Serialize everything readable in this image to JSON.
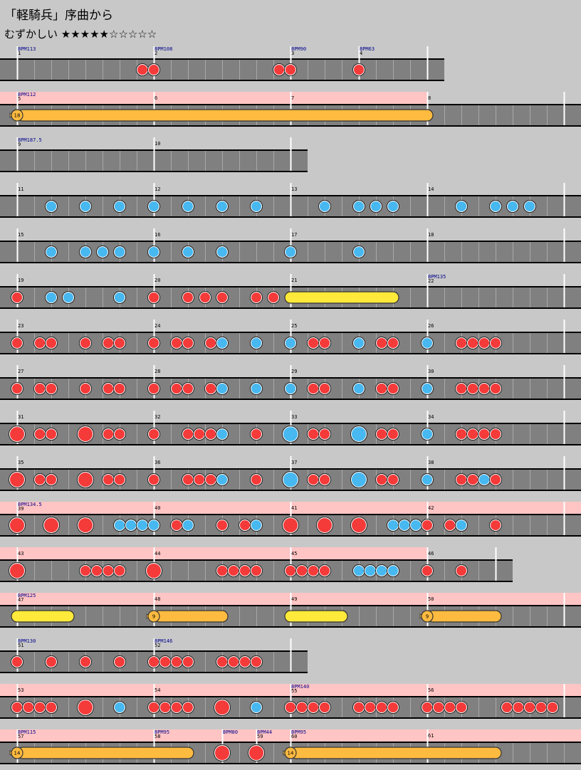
{
  "song": {
    "title": "「軽騎兵」序曲から",
    "difficulty": "むずかしい ★★★★★☆☆☆☆☆"
  },
  "colors": {
    "don": "#f53a3a",
    "ka": "#47b8f0",
    "drumroll": "#ffbb40",
    "balloon": "#ffbb40",
    "renda": "#ffe93a",
    "lane": "#808080",
    "gogo": "#ffc4c4",
    "bpm": "#00008b"
  },
  "rows": [
    {
      "width": 624,
      "gogo": false,
      "measures": [
        {
          "pos": 24,
          "num": "1",
          "bpm": "BPM113"
        },
        {
          "pos": 216,
          "num": "2",
          "bpm": "BPM108"
        },
        {
          "pos": 408,
          "num": "3",
          "bpm": "BPM90"
        },
        {
          "pos": 504,
          "num": "4",
          "bpm": "BPM63"
        },
        {
          "pos": 600,
          "num": ""
        }
      ],
      "notes": [
        [
          "d",
          200
        ],
        [
          "d",
          216
        ],
        [
          "d",
          392
        ],
        [
          "d",
          408
        ],
        [
          "d",
          504
        ]
      ]
    },
    {
      "width": 816,
      "gogo": true,
      "gogoEnd": 600,
      "measures": [
        {
          "pos": 24,
          "num": "5",
          "bpm": "BPM112"
        },
        {
          "pos": 216,
          "num": "6"
        },
        {
          "pos": 408,
          "num": "7"
        },
        {
          "pos": 600,
          "num": "8"
        },
        {
          "pos": 792,
          "num": ""
        }
      ],
      "notes": [
        [
          "balloon",
          24,
          600,
          "18"
        ]
      ]
    },
    {
      "width": 432,
      "gogo": false,
      "measures": [
        {
          "pos": 24,
          "num": "9",
          "bpm": "BPM187.5"
        },
        {
          "pos": 216,
          "num": "10"
        },
        {
          "pos": 408,
          "num": ""
        }
      ],
      "notes": []
    },
    {
      "width": 816,
      "gogo": false,
      "measures": [
        {
          "pos": 24,
          "num": "11"
        },
        {
          "pos": 216,
          "num": "12"
        },
        {
          "pos": 408,
          "num": "13"
        },
        {
          "pos": 600,
          "num": "14"
        },
        {
          "pos": 792,
          "num": ""
        }
      ],
      "notes": [
        [
          "k",
          72
        ],
        [
          "k",
          120
        ],
        [
          "k",
          168
        ],
        [
          "k",
          216
        ],
        [
          "k",
          264
        ],
        [
          "k",
          312
        ],
        [
          "k",
          360
        ],
        [
          "k",
          456
        ],
        [
          "k",
          504
        ],
        [
          "k",
          528
        ],
        [
          "k",
          552
        ],
        [
          "k",
          648
        ],
        [
          "k",
          696
        ],
        [
          "k",
          720
        ],
        [
          "k",
          744
        ]
      ]
    },
    {
      "width": 816,
      "gogo": false,
      "measures": [
        {
          "pos": 24,
          "num": "15"
        },
        {
          "pos": 216,
          "num": "16"
        },
        {
          "pos": 408,
          "num": "17"
        },
        {
          "pos": 600,
          "num": "18"
        },
        {
          "pos": 792,
          "num": ""
        }
      ],
      "notes": [
        [
          "k",
          72
        ],
        [
          "k",
          120
        ],
        [
          "k",
          144
        ],
        [
          "k",
          168
        ],
        [
          "k",
          216
        ],
        [
          "k",
          264
        ],
        [
          "k",
          312
        ],
        [
          "k",
          408
        ],
        [
          "k",
          504
        ]
      ]
    },
    {
      "width": 816,
      "gogo": false,
      "measures": [
        {
          "pos": 24,
          "num": "19"
        },
        {
          "pos": 216,
          "num": "20"
        },
        {
          "pos": 408,
          "num": "21"
        },
        {
          "pos": 600,
          "num": "22",
          "bpm": "BPM135"
        },
        {
          "pos": 792,
          "num": ""
        }
      ],
      "notes": [
        [
          "d",
          24
        ],
        [
          "k",
          72
        ],
        [
          "k",
          96
        ],
        [
          "k",
          168
        ],
        [
          "d",
          216
        ],
        [
          "d",
          264
        ],
        [
          "d",
          288
        ],
        [
          "d",
          312
        ],
        [
          "d",
          360
        ],
        [
          "d",
          384
        ],
        [
          "renda",
          408,
          552
        ]
      ]
    },
    {
      "width": 816,
      "gogo": false,
      "measures": [
        {
          "pos": 24,
          "num": "23"
        },
        {
          "pos": 216,
          "num": "24"
        },
        {
          "pos": 408,
          "num": "25"
        },
        {
          "pos": 600,
          "num": "26"
        },
        {
          "pos": 792,
          "num": ""
        }
      ],
      "notes": [
        [
          "d",
          24
        ],
        [
          "d",
          56
        ],
        [
          "d",
          72
        ],
        [
          "d",
          120
        ],
        [
          "d",
          152
        ],
        [
          "d",
          168
        ],
        [
          "d",
          216
        ],
        [
          "d",
          248
        ],
        [
          "d",
          264
        ],
        [
          "d",
          296
        ],
        [
          "k",
          312
        ],
        [
          "k",
          360
        ],
        [
          "k",
          408
        ],
        [
          "d",
          440
        ],
        [
          "d",
          456
        ],
        [
          "k",
          504
        ],
        [
          "d",
          536
        ],
        [
          "d",
          552
        ],
        [
          "k",
          600
        ],
        [
          "d",
          648
        ],
        [
          "d",
          664
        ],
        [
          "d",
          680
        ],
        [
          "d",
          696
        ]
      ]
    },
    {
      "width": 816,
      "gogo": false,
      "measures": [
        {
          "pos": 24,
          "num": "27"
        },
        {
          "pos": 216,
          "num": "28"
        },
        {
          "pos": 408,
          "num": "29"
        },
        {
          "pos": 600,
          "num": "30"
        },
        {
          "pos": 792,
          "num": ""
        }
      ],
      "notes": [
        [
          "d",
          24
        ],
        [
          "d",
          56
        ],
        [
          "d",
          72
        ],
        [
          "d",
          120
        ],
        [
          "d",
          152
        ],
        [
          "d",
          168
        ],
        [
          "d",
          216
        ],
        [
          "d",
          248
        ],
        [
          "d",
          264
        ],
        [
          "d",
          296
        ],
        [
          "k",
          312
        ],
        [
          "k",
          360
        ],
        [
          "k",
          408
        ],
        [
          "d",
          440
        ],
        [
          "d",
          456
        ],
        [
          "k",
          504
        ],
        [
          "d",
          536
        ],
        [
          "d",
          552
        ],
        [
          "k",
          600
        ],
        [
          "d",
          648
        ],
        [
          "d",
          664
        ],
        [
          "d",
          680
        ],
        [
          "d",
          696
        ]
      ]
    },
    {
      "width": 816,
      "gogo": false,
      "measures": [
        {
          "pos": 24,
          "num": "31"
        },
        {
          "pos": 216,
          "num": "32"
        },
        {
          "pos": 408,
          "num": "33"
        },
        {
          "pos": 600,
          "num": "34"
        },
        {
          "pos": 792,
          "num": ""
        }
      ],
      "notes": [
        [
          "D",
          24
        ],
        [
          "d",
          56
        ],
        [
          "d",
          72
        ],
        [
          "D",
          120
        ],
        [
          "d",
          152
        ],
        [
          "d",
          168
        ],
        [
          "d",
          216
        ],
        [
          "d",
          264
        ],
        [
          "d",
          280
        ],
        [
          "d",
          296
        ],
        [
          "k",
          312
        ],
        [
          "d",
          360
        ],
        [
          "K",
          408
        ],
        [
          "d",
          440
        ],
        [
          "d",
          456
        ],
        [
          "K",
          504
        ],
        [
          "d",
          536
        ],
        [
          "d",
          552
        ],
        [
          "k",
          600
        ],
        [
          "d",
          648
        ],
        [
          "d",
          664
        ],
        [
          "d",
          680
        ],
        [
          "d",
          696
        ]
      ]
    },
    {
      "width": 816,
      "gogo": false,
      "measures": [
        {
          "pos": 24,
          "num": "35"
        },
        {
          "pos": 216,
          "num": "36"
        },
        {
          "pos": 408,
          "num": "37"
        },
        {
          "pos": 600,
          "num": "38"
        },
        {
          "pos": 792,
          "num": ""
        }
      ],
      "notes": [
        [
          "D",
          24
        ],
        [
          "d",
          56
        ],
        [
          "d",
          72
        ],
        [
          "D",
          120
        ],
        [
          "d",
          152
        ],
        [
          "d",
          168
        ],
        [
          "d",
          216
        ],
        [
          "d",
          264
        ],
        [
          "d",
          280
        ],
        [
          "d",
          296
        ],
        [
          "k",
          312
        ],
        [
          "d",
          360
        ],
        [
          "K",
          408
        ],
        [
          "d",
          440
        ],
        [
          "d",
          456
        ],
        [
          "K",
          504
        ],
        [
          "d",
          536
        ],
        [
          "d",
          552
        ],
        [
          "k",
          600
        ],
        [
          "d",
          648
        ],
        [
          "d",
          664
        ],
        [
          "k",
          680
        ],
        [
          "d",
          696
        ]
      ]
    },
    {
      "width": 816,
      "gogo": true,
      "gogoEnd": 816,
      "measures": [
        {
          "pos": 24,
          "num": "39",
          "bpm": "BPM134.5"
        },
        {
          "pos": 216,
          "num": "40"
        },
        {
          "pos": 408,
          "num": "41"
        },
        {
          "pos": 600,
          "num": "42"
        },
        {
          "pos": 792,
          "num": ""
        }
      ],
      "notes": [
        [
          "D",
          24
        ],
        [
          "D",
          72
        ],
        [
          "D",
          120
        ],
        [
          "k",
          168
        ],
        [
          "k",
          184
        ],
        [
          "k",
          200
        ],
        [
          "k",
          216
        ],
        [
          "d",
          248
        ],
        [
          "k",
          264
        ],
        [
          "d",
          312
        ],
        [
          "d",
          344
        ],
        [
          "k",
          360
        ],
        [
          "D",
          408
        ],
        [
          "D",
          456
        ],
        [
          "D",
          504
        ],
        [
          "k",
          552
        ],
        [
          "k",
          568
        ],
        [
          "k",
          584
        ],
        [
          "d",
          600
        ],
        [
          "d",
          632
        ],
        [
          "k",
          648
        ],
        [
          "d",
          696
        ]
      ]
    },
    {
      "width": 720,
      "gogo": true,
      "gogoEnd": 600,
      "measures": [
        {
          "pos": 24,
          "num": "43"
        },
        {
          "pos": 216,
          "num": "44"
        },
        {
          "pos": 408,
          "num": "45"
        },
        {
          "pos": 600,
          "num": "46"
        },
        {
          "pos": 696,
          "num": ""
        }
      ],
      "notes": [
        [
          "D",
          24
        ],
        [
          "d",
          120
        ],
        [
          "d",
          136
        ],
        [
          "d",
          152
        ],
        [
          "d",
          168
        ],
        [
          "D",
          216
        ],
        [
          "d",
          312
        ],
        [
          "d",
          328
        ],
        [
          "d",
          344
        ],
        [
          "d",
          360
        ],
        [
          "d",
          408
        ],
        [
          "d",
          424
        ],
        [
          "d",
          440
        ],
        [
          "d",
          456
        ],
        [
          "k",
          504
        ],
        [
          "k",
          520
        ],
        [
          "k",
          536
        ],
        [
          "k",
          552
        ],
        [
          "d",
          600
        ],
        [
          "d",
          648
        ]
      ]
    },
    {
      "width": 816,
      "gogo": true,
      "gogoEnd": 816,
      "measures": [
        {
          "pos": 24,
          "num": "47",
          "bpm": "BPM125"
        },
        {
          "pos": 216,
          "num": "48"
        },
        {
          "pos": 408,
          "num": "49"
        },
        {
          "pos": 600,
          "num": "50"
        },
        {
          "pos": 792,
          "num": ""
        }
      ],
      "notes": [
        [
          "renda",
          24,
          96
        ],
        [
          "balloon",
          216,
          312,
          "9"
        ],
        [
          "renda",
          408,
          480
        ],
        [
          "balloon",
          600,
          696,
          "9"
        ]
      ]
    },
    {
      "width": 432,
      "gogo": false,
      "measures": [
        {
          "pos": 24,
          "num": "51",
          "bpm": "BPM130"
        },
        {
          "pos": 216,
          "num": "52",
          "bpm": "BPM146"
        },
        {
          "pos": 408,
          "num": ""
        }
      ],
      "notes": [
        [
          "d",
          24
        ],
        [
          "d",
          72
        ],
        [
          "d",
          120
        ],
        [
          "d",
          168
        ],
        [
          "d",
          216
        ],
        [
          "d",
          232
        ],
        [
          "d",
          248
        ],
        [
          "d",
          264
        ],
        [
          "d",
          312
        ],
        [
          "d",
          328
        ],
        [
          "d",
          344
        ],
        [
          "d",
          360
        ]
      ]
    },
    {
      "width": 816,
      "gogo": true,
      "gogoEnd": 816,
      "measures": [
        {
          "pos": 24,
          "num": "53"
        },
        {
          "pos": 216,
          "num": "54"
        },
        {
          "pos": 408,
          "num": "55",
          "bpm": "BPM140"
        },
        {
          "pos": 600,
          "num": "56"
        },
        {
          "pos": 792,
          "num": ""
        }
      ],
      "notes": [
        [
          "d",
          24
        ],
        [
          "d",
          40
        ],
        [
          "d",
          56
        ],
        [
          "d",
          72
        ],
        [
          "D",
          120
        ],
        [
          "k",
          168
        ],
        [
          "d",
          216
        ],
        [
          "d",
          232
        ],
        [
          "d",
          248
        ],
        [
          "d",
          264
        ],
        [
          "D",
          312
        ],
        [
          "k",
          360
        ],
        [
          "d",
          408
        ],
        [
          "d",
          424
        ],
        [
          "d",
          440
        ],
        [
          "d",
          456
        ],
        [
          "d",
          504
        ],
        [
          "d",
          520
        ],
        [
          "d",
          536
        ],
        [
          "d",
          552
        ],
        [
          "d",
          600
        ],
        [
          "d",
          616
        ],
        [
          "d",
          632
        ],
        [
          "d",
          648
        ],
        [
          "d",
          712
        ],
        [
          "d",
          728
        ],
        [
          "d",
          744
        ],
        [
          "d",
          760
        ],
        [
          "d",
          776
        ]
      ]
    },
    {
      "width": 816,
      "gogo": true,
      "gogoEnd": 816,
      "measures": [
        {
          "pos": 24,
          "num": "57",
          "bpm": "BPM115"
        },
        {
          "pos": 216,
          "num": "58",
          "bpm": "BPM95"
        },
        {
          "pos": 312,
          "num": "",
          "bpm": "BPM80"
        },
        {
          "pos": 360,
          "num": "59",
          "bpm": "BPM44"
        },
        {
          "pos": 408,
          "num": "60",
          "bpm": "BPM95"
        },
        {
          "pos": 600,
          "num": "61"
        }
      ],
      "notes": [
        [
          "balloon",
          24,
          264,
          "14"
        ],
        [
          "D",
          312
        ],
        [
          "D",
          360
        ],
        [
          "balloon",
          408,
          696,
          "14"
        ]
      ]
    }
  ]
}
